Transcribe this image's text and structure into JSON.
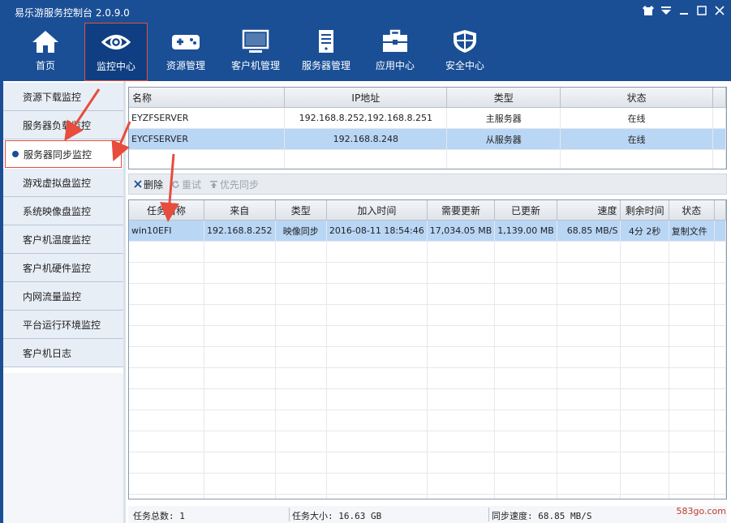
{
  "window": {
    "title": "易乐游服务控制台 2.0.9.0"
  },
  "nav": {
    "items": [
      {
        "label": "首页",
        "icon": "home-icon"
      },
      {
        "label": "监控中心",
        "icon": "eye-icon"
      },
      {
        "label": "资源管理",
        "icon": "gamepad-icon"
      },
      {
        "label": "客户机管理",
        "icon": "monitor-icon"
      },
      {
        "label": "服务器管理",
        "icon": "server-icon"
      },
      {
        "label": "应用中心",
        "icon": "toolbox-icon"
      },
      {
        "label": "安全中心",
        "icon": "shield-icon"
      }
    ]
  },
  "sidebar": {
    "items": [
      {
        "label": "资源下载监控"
      },
      {
        "label": "服务器负载监控"
      },
      {
        "label": "服务器同步监控"
      },
      {
        "label": "游戏虚拟盘监控"
      },
      {
        "label": "系统映像盘监控"
      },
      {
        "label": "客户机温度监控"
      },
      {
        "label": "客户机硬件监控"
      },
      {
        "label": "内网流量监控"
      },
      {
        "label": "平台运行环境监控"
      },
      {
        "label": "客户机日志"
      }
    ]
  },
  "servers": {
    "columns": [
      "名称",
      "IP地址",
      "类型",
      "状态"
    ],
    "rows": [
      {
        "name": "EYZFSERVER",
        "ip": "192.168.8.252,192.168.8.251",
        "type": "主服务器",
        "status": "在线"
      },
      {
        "name": "EYCFSERVER",
        "ip": "192.168.8.248",
        "type": "从服务器",
        "status": "在线"
      }
    ]
  },
  "toolbar": {
    "delete": "删除",
    "retry": "重试",
    "priority": "优先同步"
  },
  "tasks": {
    "columns": [
      "任务名称",
      "来自",
      "类型",
      "加入时间",
      "需要更新",
      "已更新",
      "速度",
      "剩余时间",
      "状态"
    ],
    "rows": [
      {
        "name": "win10EFI",
        "from": "192.168.8.252",
        "type": "映像同步",
        "time": "2016-08-11 18:54:46",
        "need": "17,034.05 MB",
        "done": "1,139.00 MB",
        "speed": "68.85 MB/S",
        "remain": "4分 2秒",
        "status": "复制文件"
      }
    ]
  },
  "status": {
    "count": "任务总数: 1",
    "size": "任务大小: 16.63 GB",
    "speed": "同步速度: 68.85 MB/S"
  },
  "watermark": "583go.com",
  "colors": {
    "brand": "#1a4f96",
    "selection": "#b9d6f5",
    "highlight": "#e74c3c"
  }
}
